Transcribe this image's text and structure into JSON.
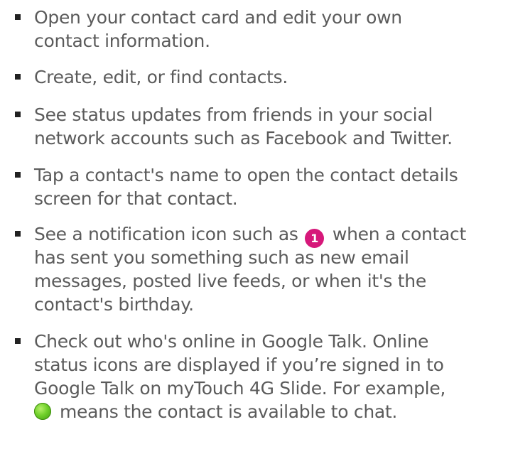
{
  "items": [
    {
      "lines": [
        "Open your contact card and edit your own",
        "contact information."
      ]
    },
    {
      "lines": [
        "Create, edit, or find contacts."
      ]
    },
    {
      "lines": [
        "See status updates from friends in your social",
        "network accounts such as Facebook and Twitter."
      ]
    },
    {
      "lines": [
        "Tap a contact's name to open the contact details",
        "screen for that contact."
      ]
    },
    {
      "line1_before": "See a notification icon such as",
      "badge_text": "1",
      "line1_after": "when a contact",
      "lines": [
        "has sent you something such as new email",
        "messages, posted live feeds, or when it's the",
        "contact's birthday."
      ]
    },
    {
      "lines": [
        "Check out who's online in Google Talk. Online",
        "status icons are displayed if you’re signed in to",
        "Google Talk on myTouch 4G Slide. For example,"
      ],
      "last_line_after_icon": "means the contact is available to chat."
    }
  ],
  "icons": {
    "notification_badge": "notification-badge-icon",
    "notification_badge_color": "#d6187a",
    "online_status": "online-status-icon",
    "online_status_color": "#6fcf2a"
  }
}
